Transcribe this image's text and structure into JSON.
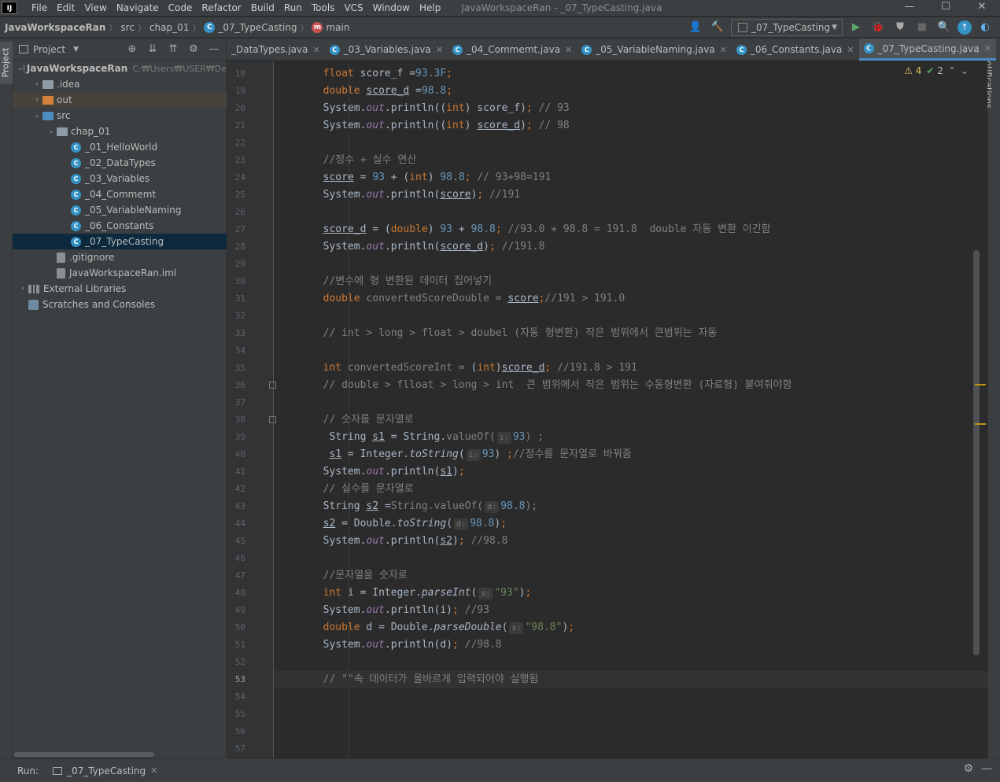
{
  "app": {
    "logo_text": "IJ",
    "window_title": "JavaWorkspaceRan - _07_TypeCasting.java",
    "menu": [
      "File",
      "Edit",
      "View",
      "Navigate",
      "Code",
      "Refactor",
      "Build",
      "Run",
      "Tools",
      "VCS",
      "Window",
      "Help"
    ]
  },
  "nav": {
    "breadcrumb": [
      "JavaWorkspaceRan",
      "src",
      "chap_01",
      "_07_TypeCasting",
      "main"
    ],
    "run_config": "_07_TypeCasting"
  },
  "project_panel": {
    "title": "Project",
    "stripe_label": "Project",
    "tree": [
      {
        "label": "JavaWorkspaceRan",
        "hint": "C:₩Users₩USER₩De",
        "type": "module",
        "level": 0,
        "arrow": "open"
      },
      {
        "label": ".idea",
        "type": "folder",
        "level": 1,
        "arrow": "closed"
      },
      {
        "label": "out",
        "type": "folder-orange",
        "level": 1,
        "arrow": "closed"
      },
      {
        "label": "src",
        "type": "folder-blue",
        "level": 1,
        "arrow": "open"
      },
      {
        "label": "chap_01",
        "type": "folder",
        "level": 2,
        "arrow": "open"
      },
      {
        "label": "_01_HelloWorld",
        "type": "class",
        "level": 3
      },
      {
        "label": "_02_DataTypes",
        "type": "class",
        "level": 3
      },
      {
        "label": "_03_Variables",
        "type": "class",
        "level": 3
      },
      {
        "label": "_04_Commemt",
        "type": "class",
        "level": 3
      },
      {
        "label": "_05_VariableNaming",
        "type": "class",
        "level": 3
      },
      {
        "label": "_06_Constants",
        "type": "class",
        "level": 3
      },
      {
        "label": "_07_TypeCasting",
        "type": "class",
        "level": 3,
        "selected": true
      },
      {
        "label": ".gitignore",
        "type": "file",
        "level": 2
      },
      {
        "label": "JavaWorkspaceRan.iml",
        "type": "file",
        "level": 2
      },
      {
        "label": "External Libraries",
        "type": "lib",
        "level": 0,
        "arrow": "closed"
      },
      {
        "label": "Scratches and Consoles",
        "type": "scratch",
        "level": 0
      }
    ]
  },
  "tabs": [
    {
      "label": "_DataTypes.java",
      "icon": false
    },
    {
      "label": "_03_Variables.java",
      "icon": true
    },
    {
      "label": "_04_Commemt.java",
      "icon": true
    },
    {
      "label": "_05_VariableNaming.java",
      "icon": true
    },
    {
      "label": "_06_Constants.java",
      "icon": true
    },
    {
      "label": "_07_TypeCasting.java",
      "icon": true,
      "active": true
    }
  ],
  "inspection": {
    "warnings": "4",
    "ok": "2"
  },
  "notifications_label": "Notifications",
  "editor": {
    "first_line": 18,
    "current_line": 53,
    "lines": [
      [
        [
          "        "
        ],
        [
          "float ",
          "kw"
        ],
        [
          "score_f =",
          "plain"
        ],
        [
          "93.3F",
          "num"
        ],
        [
          ";",
          "kw"
        ]
      ],
      [
        [
          "        "
        ],
        [
          "double ",
          "kw"
        ],
        [
          "score_d",
          "ul"
        ],
        [
          " =",
          "plain"
        ],
        [
          "98.8",
          "num"
        ],
        [
          ";",
          "kw"
        ]
      ],
      [
        [
          "        System."
        ],
        [
          "out",
          "fld"
        ],
        [
          ".println(("
        ],
        [
          "int",
          "kw"
        ],
        [
          ") score_f)"
        ],
        [
          "; ",
          "kw"
        ],
        [
          "// 93",
          "cmt"
        ]
      ],
      [
        [
          "        System."
        ],
        [
          "out",
          "fld"
        ],
        [
          ".println(("
        ],
        [
          "int",
          "kw"
        ],
        [
          ") "
        ],
        [
          "score_d",
          "ul"
        ],
        [
          ")"
        ],
        [
          "; ",
          "kw"
        ],
        [
          "// 98",
          "cmt"
        ]
      ],
      [
        [
          ""
        ]
      ],
      [
        [
          "        "
        ],
        [
          "//정수 + 실수 연산",
          "cmt"
        ]
      ],
      [
        [
          "        "
        ],
        [
          "score",
          "ul"
        ],
        [
          " = "
        ],
        [
          "93",
          "num"
        ],
        [
          " + ("
        ],
        [
          "int",
          "kw"
        ],
        [
          ") "
        ],
        [
          "98.8",
          "num"
        ],
        [
          "; ",
          "kw"
        ],
        [
          "// 93+98=191",
          "cmt"
        ]
      ],
      [
        [
          "        System."
        ],
        [
          "out",
          "fld"
        ],
        [
          ".println("
        ],
        [
          "score",
          "ul"
        ],
        [
          ")"
        ],
        [
          "; ",
          "kw"
        ],
        [
          "//191",
          "cmt"
        ]
      ],
      [
        [
          ""
        ]
      ],
      [
        [
          "        "
        ],
        [
          "score_d",
          "ul"
        ],
        [
          " = ("
        ],
        [
          "double",
          "kw"
        ],
        [
          ") "
        ],
        [
          "93",
          "num"
        ],
        [
          " + "
        ],
        [
          "98.8",
          "num"
        ],
        [
          "; ",
          "kw"
        ],
        [
          "//93.0 + 98.8 = 191.8  double 자동 변환 이긴함",
          "cmt"
        ]
      ],
      [
        [
          "        System."
        ],
        [
          "out",
          "fld"
        ],
        [
          ".println("
        ],
        [
          "score_d",
          "ul"
        ],
        [
          ")"
        ],
        [
          "; ",
          "kw"
        ],
        [
          "//191.8",
          "cmt"
        ]
      ],
      [
        [
          ""
        ]
      ],
      [
        [
          "        "
        ],
        [
          "//변수에 형 변환된 데이터 집어넣기",
          "cmt"
        ]
      ],
      [
        [
          "        "
        ],
        [
          "double ",
          "kw"
        ],
        [
          "convertedScoreDouble = ",
          "cmt"
        ],
        [
          "score",
          "ul"
        ],
        [
          ";",
          "kw"
        ],
        [
          "//191 > 191.0",
          "cmt"
        ]
      ],
      [
        [
          ""
        ]
      ],
      [
        [
          "        "
        ],
        [
          "// int > long > float > doubel (자동 형변환) 작은 범위에서 큰범위는 자동",
          "cmt"
        ]
      ],
      [
        [
          ""
        ]
      ],
      [
        [
          "        "
        ],
        [
          "int ",
          "kw"
        ],
        [
          "convertedScoreInt = ",
          "cmt"
        ],
        [
          "("
        ],
        [
          "int",
          "kw"
        ],
        [
          ")"
        ],
        [
          "score_d",
          "ul"
        ],
        [
          "; ",
          "kw"
        ],
        [
          "//191.8 > 191",
          "cmt"
        ]
      ],
      [
        [
          "        "
        ],
        [
          "// double > flloat > long > int  큰 범위에서 작은 범위는 수동형변환 (자료형) 붙여줘야함",
          "cmt"
        ]
      ],
      [
        [
          ""
        ]
      ],
      [
        [
          "        "
        ],
        [
          "// 숫자를 문자열로",
          "cmt"
        ]
      ],
      [
        [
          "         String "
        ],
        [
          "s1",
          "ul"
        ],
        [
          " = String."
        ],
        [
          "valueOf(",
          "cmt"
        ],
        [
          "i:",
          "hint"
        ],
        [
          "93",
          "num"
        ],
        [
          ") ;",
          "cmt"
        ]
      ],
      [
        [
          "         "
        ],
        [
          "s1",
          "ul"
        ],
        [
          " = Integer."
        ],
        [
          "toString",
          "mth"
        ],
        [
          "("
        ],
        [
          "i:",
          "hint"
        ],
        [
          "93",
          "num"
        ],
        [
          ") "
        ],
        [
          ";",
          "kw"
        ],
        [
          "//정수를 문자열로 바꿔줌",
          "cmt"
        ]
      ],
      [
        [
          "        System."
        ],
        [
          "out",
          "fld"
        ],
        [
          ".println("
        ],
        [
          "s1",
          "ul"
        ],
        [
          ")"
        ],
        [
          ";",
          "kw"
        ]
      ],
      [
        [
          "        "
        ],
        [
          "// 실수를 문자열로",
          "cmt"
        ]
      ],
      [
        [
          "        String "
        ],
        [
          "s2",
          "ul"
        ],
        [
          " ="
        ],
        [
          "String.",
          "cmt"
        ],
        [
          "valueOf(",
          "cmt"
        ],
        [
          "d:",
          "hint"
        ],
        [
          "98.8",
          "num"
        ],
        [
          ");",
          "cmt"
        ]
      ],
      [
        [
          "        "
        ],
        [
          "s2",
          "ul"
        ],
        [
          " = Double."
        ],
        [
          "toString",
          "mth"
        ],
        [
          "("
        ],
        [
          "d:",
          "hint"
        ],
        [
          "98.8",
          "num"
        ],
        [
          ")"
        ],
        [
          ";",
          "kw"
        ]
      ],
      [
        [
          "        System."
        ],
        [
          "out",
          "fld"
        ],
        [
          ".println("
        ],
        [
          "s2",
          "ul"
        ],
        [
          ")"
        ],
        [
          "; ",
          "kw"
        ],
        [
          "//98.8",
          "cmt"
        ]
      ],
      [
        [
          ""
        ]
      ],
      [
        [
          "        "
        ],
        [
          "//문자열을 숫자로",
          "cmt"
        ]
      ],
      [
        [
          "        "
        ],
        [
          "int ",
          "kw"
        ],
        [
          "i = Integer."
        ],
        [
          "parseInt",
          "mth"
        ],
        [
          "("
        ],
        [
          "s:",
          "hint"
        ],
        [
          "\"93\"",
          "str"
        ],
        [
          ")"
        ],
        [
          ";",
          "kw"
        ]
      ],
      [
        [
          "        System."
        ],
        [
          "out",
          "fld"
        ],
        [
          ".println(i)"
        ],
        [
          "; ",
          "kw"
        ],
        [
          "//93",
          "cmt"
        ]
      ],
      [
        [
          "        "
        ],
        [
          "double ",
          "kw"
        ],
        [
          "d = Double."
        ],
        [
          "parseDouble",
          "mth"
        ],
        [
          "("
        ],
        [
          "s:",
          "hint"
        ],
        [
          "\"98.8\"",
          "str"
        ],
        [
          ")"
        ],
        [
          ";",
          "kw"
        ]
      ],
      [
        [
          "        System."
        ],
        [
          "out",
          "fld"
        ],
        [
          ".println(d)"
        ],
        [
          "; ",
          "kw"
        ],
        [
          "//98.8",
          "cmt"
        ]
      ],
      [
        [
          ""
        ]
      ],
      [
        [
          "        "
        ],
        [
          "// \"\"속 데이터가 올바르게 입력되어야 실행됨",
          "cmt"
        ]
      ],
      [
        [
          ""
        ]
      ],
      [
        [
          ""
        ]
      ],
      [
        [
          ""
        ]
      ],
      [
        [
          ""
        ]
      ]
    ]
  },
  "run_bar": {
    "label": "Run:",
    "tab": "_07_TypeCasting"
  }
}
